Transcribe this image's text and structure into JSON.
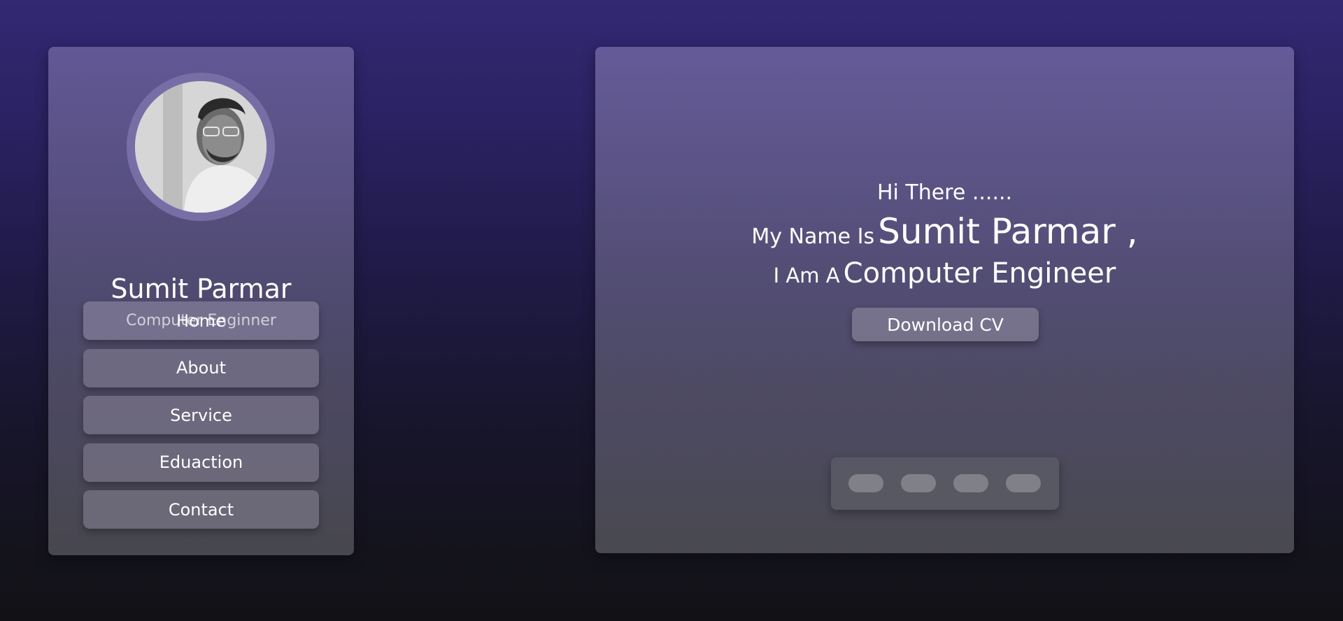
{
  "profile": {
    "name": "Sumit Parmar",
    "role": "Computer Enginner"
  },
  "nav": {
    "items": [
      {
        "label": "Home"
      },
      {
        "label": "About"
      },
      {
        "label": "Service"
      },
      {
        "label": "Eduaction"
      },
      {
        "label": "Contact"
      }
    ]
  },
  "hero": {
    "greeting": "Hi There ......",
    "name_prefix": "My Name Is",
    "name": "Sumit Parmar ,",
    "role_prefix": "I Am A",
    "role": "Computer Engineer",
    "cv_button_label": "Download CV"
  },
  "social": {
    "icons": [
      "social-icon-1",
      "social-icon-2",
      "social-icon-3",
      "social-icon-4"
    ]
  },
  "colors": {
    "background_top": "#332873",
    "background_bottom": "#121215",
    "avatar_ring": "#786ea6"
  }
}
